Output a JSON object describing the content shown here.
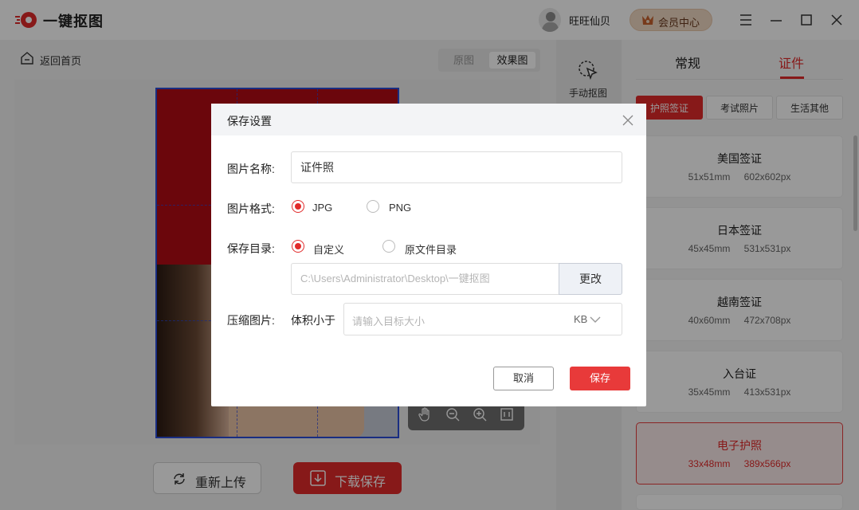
{
  "app": {
    "title": "一键抠图",
    "username": "旺旺仙贝",
    "vip_label": "会员中心"
  },
  "icons": {
    "logo": "logo-icon",
    "vip": "crown-icon",
    "menu": "menu-icon",
    "minimize": "minimize-icon",
    "maximize": "maximize-icon",
    "close": "close-icon",
    "back": "home-icon",
    "manual": "cursor-select-icon",
    "hand": "hand-icon",
    "zoom_out": "zoom-out-icon",
    "zoom_in": "zoom-in-icon",
    "fit": "fit-screen-icon",
    "refresh": "refresh-icon",
    "download": "download-icon",
    "dialog_close": "close-icon",
    "chevron": "chevron-down-icon"
  },
  "colors": {
    "accent": "#e12b2b",
    "photo_bg": "#b30a14",
    "selection": "#2a4bd9"
  },
  "toolbar": {
    "back_label": "返回首页",
    "toggle_original": "原图",
    "toggle_effect": "效果图",
    "manual_label": "手动抠图"
  },
  "actions": {
    "reupload": "重新上传",
    "download": "下载保存"
  },
  "right": {
    "tabs": [
      "常规",
      "证件"
    ],
    "subtabs": [
      "护照签证",
      "考试照片",
      "生活其他"
    ],
    "cards": [
      {
        "title": "美国签证",
        "mm": "51x51mm",
        "px": "602x602px"
      },
      {
        "title": "日本签证",
        "mm": "45x45mm",
        "px": "531x531px"
      },
      {
        "title": "越南签证",
        "mm": "40x60mm",
        "px": "472x708px"
      },
      {
        "title": "入台证",
        "mm": "35x45mm",
        "px": "413x531px"
      },
      {
        "title": "电子护照",
        "mm": "33x48mm",
        "px": "389x566px"
      }
    ]
  },
  "dialog": {
    "title": "保存设置",
    "name_label": "图片名称:",
    "name_value": "证件照",
    "format_label": "图片格式:",
    "format_options": [
      "JPG",
      "PNG"
    ],
    "format_selected": "JPG",
    "dir_label": "保存目录:",
    "dir_options": [
      "自定义",
      "原文件目录"
    ],
    "dir_selected": "自定义",
    "dir_path": "C:\\Users\\Administrator\\Desktop\\一键抠图",
    "dir_button": "更改",
    "compress_label": "压缩图片:",
    "size_label": "体积小于",
    "size_placeholder": "请输入目标大小",
    "size_unit": "KB",
    "cancel": "取消",
    "save": "保存"
  }
}
